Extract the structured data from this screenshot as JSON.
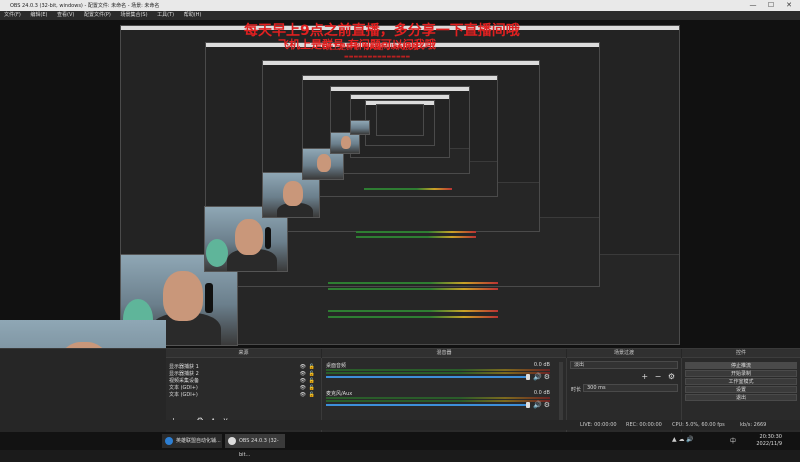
{
  "window": {
    "title": "OBS 24.0.3 (32-bit, windows) - 配置文件: 未命名 - 场景: 未命名",
    "minimize": "—",
    "maximize": "☐",
    "close": "✕"
  },
  "menu": [
    "文件(F)",
    "编辑(E)",
    "查看(V)",
    "配置文件(P)",
    "场景集合(S)",
    "工具(T)",
    "帮助(H)"
  ],
  "overlay": {
    "line1": "每天早上9点之前直播，多分享一下直播间哦",
    "line2": "飞机上是群号 有问题可以问我哦",
    "line3": "飞机上是群号 有问题可以问我哦"
  },
  "docks": {
    "sources_header": "来源",
    "mixer_header": "混音器",
    "transitions_header": "场景过渡",
    "controls_header": "控件"
  },
  "sources": [
    {
      "name": "显示器捕获 1",
      "eye": "👁",
      "lock": "🔓"
    },
    {
      "name": "显示器捕获 2",
      "eye": "👁",
      "lock": "🔓"
    },
    {
      "name": "视频采集设备",
      "eye": "👁",
      "lock": "🔓"
    },
    {
      "name": "文本 (GDI+)",
      "eye": "👁",
      "lock": "🔓"
    },
    {
      "name": "文本 (GDI+)",
      "eye": "👁",
      "lock": "🔓"
    }
  ],
  "source_tools": {
    "add": "+",
    "remove": "−",
    "settings": "⚙",
    "up": "∧",
    "down": "∨"
  },
  "mixer": [
    {
      "name": "桌面音频",
      "db": "0.0 dB",
      "vol_icon": "🔊",
      "gear": "⚙"
    },
    {
      "name": "麦克风/Aux",
      "db": "0.0 dB",
      "vol_icon": "🔊",
      "gear": "⚙"
    }
  ],
  "transitions": {
    "selected": "淡出",
    "add": "+",
    "remove": "−",
    "gear": "⚙",
    "duration_label": "时长",
    "duration_value": "300 ms"
  },
  "controls": {
    "buttons": [
      "停止推流",
      "开始录制",
      "工作室模式",
      "设置",
      "退出"
    ]
  },
  "status": {
    "live": "LIVE: 00:00:00",
    "rec": "REC: 00:00:00",
    "cpu": "CPU: 5.0%, 60.00 fps",
    "kbps": "kb/s: 2669"
  },
  "taskbar": {
    "item1": "英雄联盟自动化辅...",
    "item2": "OBS 24.0.3 (32-bit...",
    "time": "20:30:30",
    "date": "2022/11/9",
    "tray_lang": "中",
    "tray_icons": "▲ ☁ 🔊"
  }
}
